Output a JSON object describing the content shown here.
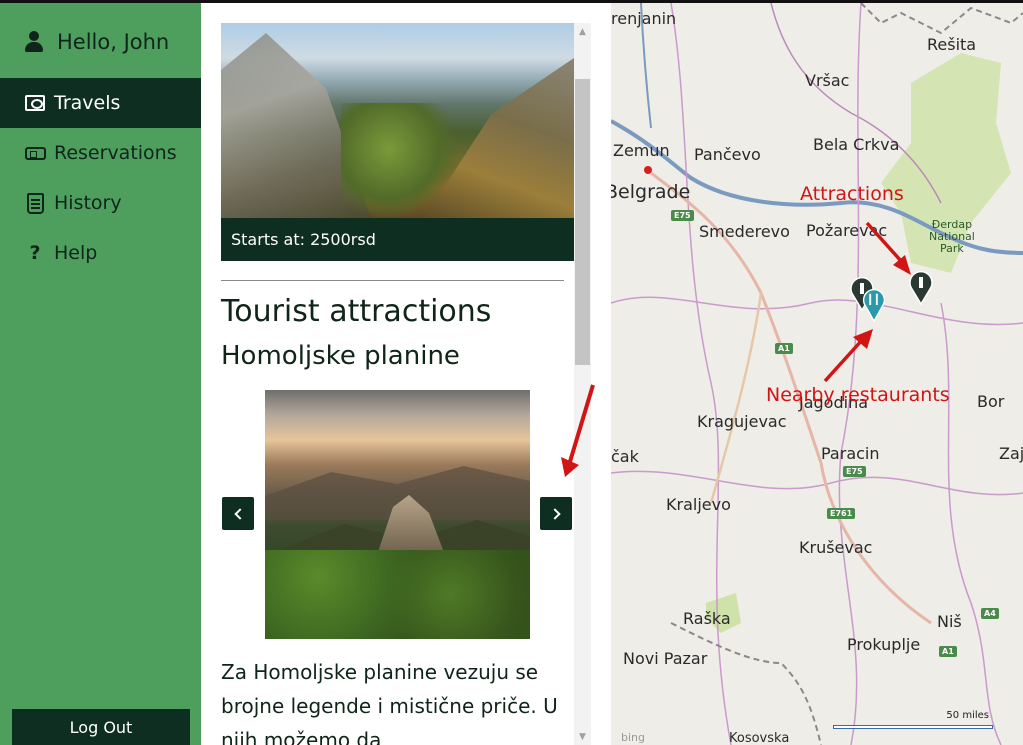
{
  "user": {
    "greeting": "Hello, John",
    "icon": "user-icon"
  },
  "sidebar": {
    "items": [
      {
        "label": "Travels",
        "icon": "map-icon",
        "active": true
      },
      {
        "label": "Reservations",
        "icon": "ticket-icon",
        "active": false
      },
      {
        "label": "History",
        "icon": "scroll-icon",
        "active": false
      },
      {
        "label": "Help",
        "icon": "question-icon",
        "active": false
      }
    ],
    "logout_label": "Log Out"
  },
  "content": {
    "hero_caption": "Starts at: 2500rsd",
    "section_title": "Tourist attractions",
    "place_title": "Homoljske planine",
    "description": "Za Homoljske planine vezuju se brojne legende i mistične priče. U njih možemo da"
  },
  "map": {
    "cities": [
      {
        "name": "renjanin"
      },
      {
        "name": "Rešita"
      },
      {
        "name": "Vršac"
      },
      {
        "name": "Zemun"
      },
      {
        "name": "Pančevo"
      },
      {
        "name": "Bela Crkva"
      },
      {
        "name": "Belgrade"
      },
      {
        "name": "Smederevo"
      },
      {
        "name": "Požarevac"
      },
      {
        "name": "Jagodina"
      },
      {
        "name": "Kragujevac"
      },
      {
        "name": "Paracin"
      },
      {
        "name": "Bor"
      },
      {
        "name": "Zaj"
      },
      {
        "name": "čak"
      },
      {
        "name": "Kraljevo"
      },
      {
        "name": "Kruševac"
      },
      {
        "name": "Raška"
      },
      {
        "name": "Niš"
      },
      {
        "name": "Novi Pazar"
      },
      {
        "name": "Prokuplje"
      },
      {
        "name": "Kosovska"
      }
    ],
    "park_label": "Đerdap\nNational\nPark",
    "roads": [
      "E75",
      "A1",
      "E75",
      "E761",
      "A1",
      "A4"
    ],
    "annotations": {
      "attractions": "Attractions",
      "restaurants": "Nearby restaurants"
    },
    "scale_text": "50 miles",
    "bing": "bing",
    "annotation_color": "#d11515",
    "accent_dark": "#0e2e22",
    "sidebar_green": "#4e9e5e"
  }
}
